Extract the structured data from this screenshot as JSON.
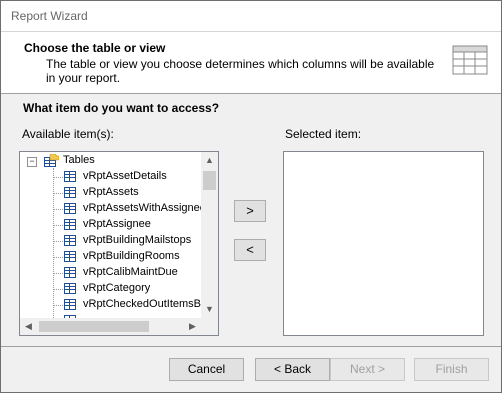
{
  "window": {
    "title": "Report Wizard"
  },
  "header": {
    "title": "Choose the table or view",
    "description": "The table or view you choose determines which columns will be available in your report.",
    "icon": "table-icon"
  },
  "question": "What item do you want to access?",
  "available": {
    "label": "Available item(s):",
    "root": "Tables",
    "items": [
      "vRptAssetDetails",
      "vRptAssets",
      "vRptAssetsWithAssignee",
      "vRptAssignee",
      "vRptBuildingMailstops",
      "vRptBuildingRooms",
      "vRptCalibMaintDue",
      "vRptCategory",
      "vRptCheckedOutItemsBy"
    ]
  },
  "selected": {
    "label": "Selected item:"
  },
  "move": {
    "add": ">",
    "remove": "<"
  },
  "buttons": {
    "cancel": "Cancel",
    "back": "< Back",
    "next": "Next >",
    "finish": "Finish"
  }
}
